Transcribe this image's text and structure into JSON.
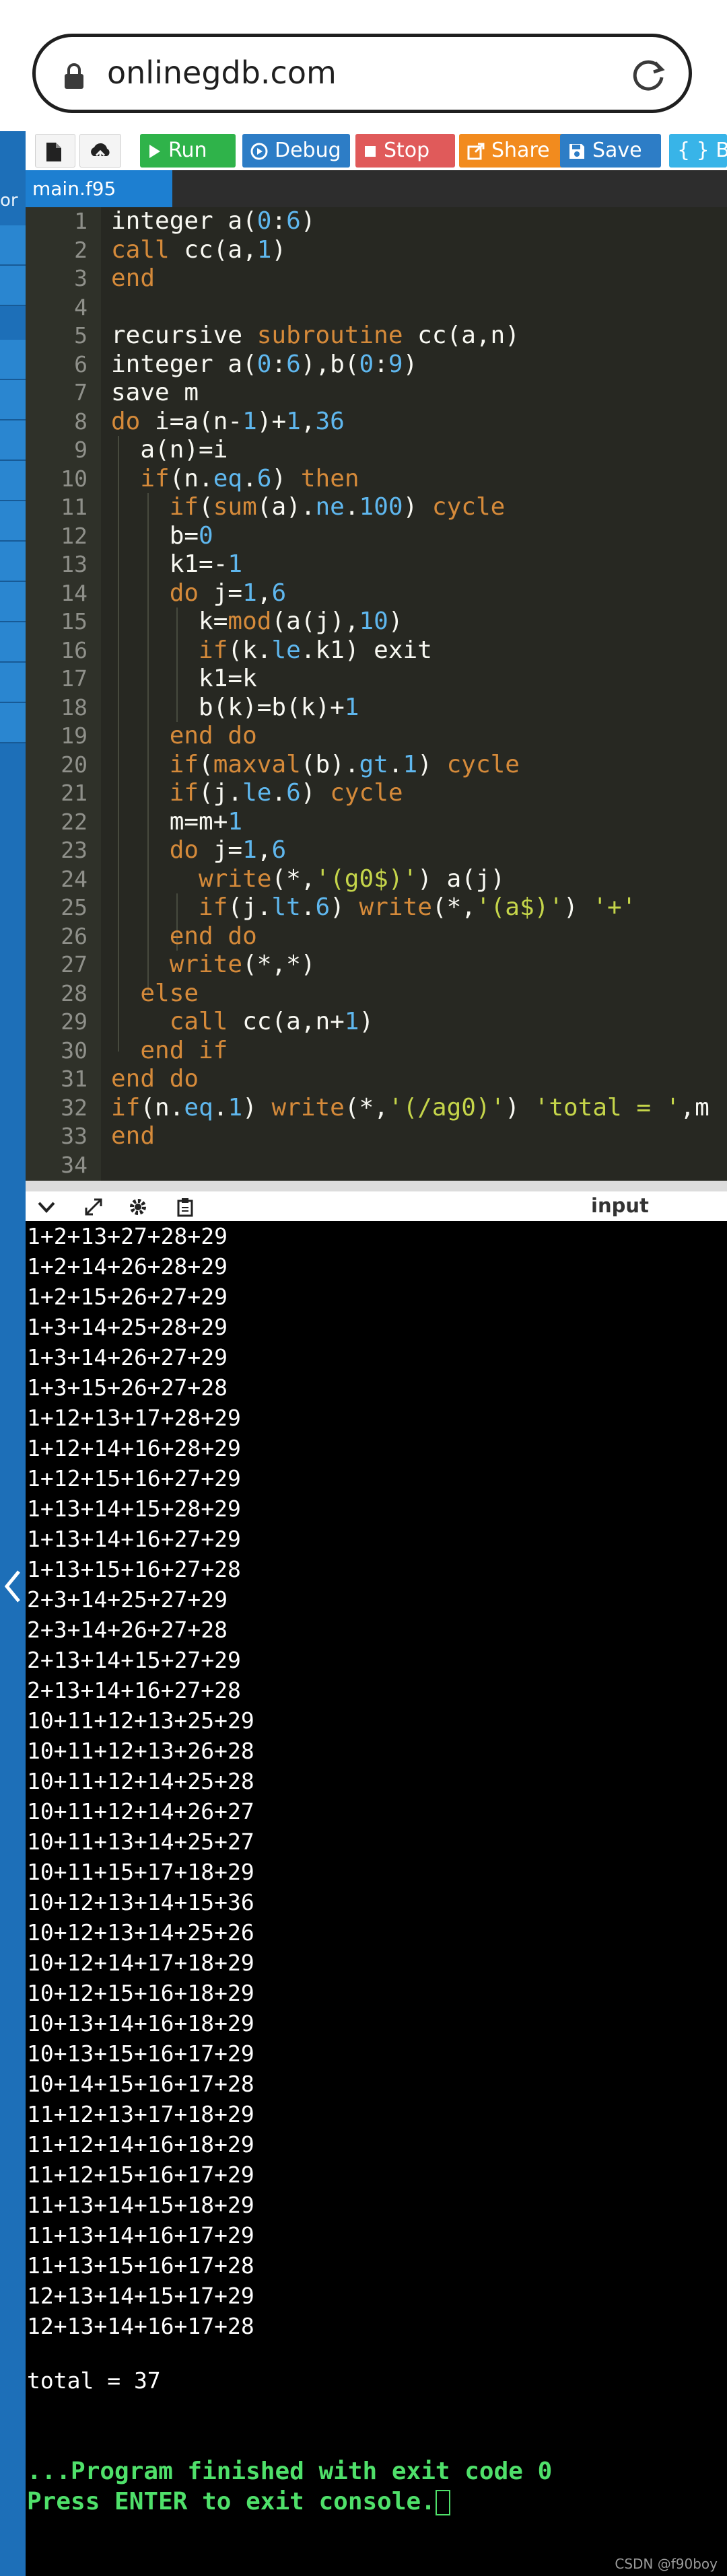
{
  "browser": {
    "url": "onlinegdb.com"
  },
  "sidebar": {
    "partial_label": "or"
  },
  "toolbar": {
    "run_label": "Run",
    "debug_label": "Debug",
    "stop_label": "Stop",
    "share_label": "Share",
    "save_label": "Save",
    "beautify_label": "{ } Bea"
  },
  "editor": {
    "tab_name": "main.f95",
    "lines": [
      [
        {
          "t": "integer a("
        },
        {
          "t": "0",
          "c": "n"
        },
        {
          "t": ":"
        },
        {
          "t": "6",
          "c": "n"
        },
        {
          "t": ")"
        }
      ],
      [
        {
          "t": "call",
          "c": "k"
        },
        {
          "t": " cc(a,"
        },
        {
          "t": "1",
          "c": "n"
        },
        {
          "t": ")"
        }
      ],
      [
        {
          "t": "end",
          "c": "k"
        }
      ],
      [],
      [
        {
          "t": "recursive ",
          "c": ""
        },
        {
          "t": "subroutine",
          "c": "k"
        },
        {
          "t": " cc(a,n)"
        }
      ],
      [
        {
          "t": "integer a("
        },
        {
          "t": "0",
          "c": "n"
        },
        {
          "t": ":"
        },
        {
          "t": "6",
          "c": "n"
        },
        {
          "t": "),b("
        },
        {
          "t": "0",
          "c": "n"
        },
        {
          "t": ":"
        },
        {
          "t": "9",
          "c": "n"
        },
        {
          "t": ")"
        }
      ],
      [
        {
          "t": "save m"
        }
      ],
      [
        {
          "t": "do",
          "c": "k"
        },
        {
          "t": " i=a(n-"
        },
        {
          "t": "1",
          "c": "n"
        },
        {
          "t": ")+"
        },
        {
          "t": "1",
          "c": "n"
        },
        {
          "t": ","
        },
        {
          "t": "36",
          "c": "n"
        }
      ],
      [
        {
          "t": "  a(n)=i"
        }
      ],
      [
        {
          "t": "  "
        },
        {
          "t": "if",
          "c": "k"
        },
        {
          "t": "(n."
        },
        {
          "t": "eq",
          "c": "n"
        },
        {
          "t": "."
        },
        {
          "t": "6",
          "c": "n"
        },
        {
          "t": ") "
        },
        {
          "t": "then",
          "c": "k"
        }
      ],
      [
        {
          "t": "    "
        },
        {
          "t": "if",
          "c": "k"
        },
        {
          "t": "("
        },
        {
          "t": "sum",
          "c": "k"
        },
        {
          "t": "(a)."
        },
        {
          "t": "ne",
          "c": "n"
        },
        {
          "t": "."
        },
        {
          "t": "100",
          "c": "n"
        },
        {
          "t": ") "
        },
        {
          "t": "cycle",
          "c": "k"
        }
      ],
      [
        {
          "t": "    b="
        },
        {
          "t": "0",
          "c": "n"
        }
      ],
      [
        {
          "t": "    k1=-"
        },
        {
          "t": "1",
          "c": "n"
        }
      ],
      [
        {
          "t": "    "
        },
        {
          "t": "do",
          "c": "k"
        },
        {
          "t": " j="
        },
        {
          "t": "1",
          "c": "n"
        },
        {
          "t": ","
        },
        {
          "t": "6",
          "c": "n"
        }
      ],
      [
        {
          "t": "      k="
        },
        {
          "t": "mod",
          "c": "k"
        },
        {
          "t": "(a(j),"
        },
        {
          "t": "10",
          "c": "n"
        },
        {
          "t": ")"
        }
      ],
      [
        {
          "t": "      "
        },
        {
          "t": "if",
          "c": "k"
        },
        {
          "t": "(k."
        },
        {
          "t": "le",
          "c": "n"
        },
        {
          "t": ".k1) exit"
        }
      ],
      [
        {
          "t": "      k1=k"
        }
      ],
      [
        {
          "t": "      b(k)=b(k)+"
        },
        {
          "t": "1",
          "c": "n"
        }
      ],
      [
        {
          "t": "    "
        },
        {
          "t": "end do",
          "c": "k"
        }
      ],
      [
        {
          "t": "    "
        },
        {
          "t": "if",
          "c": "k"
        },
        {
          "t": "("
        },
        {
          "t": "maxval",
          "c": "k"
        },
        {
          "t": "(b)."
        },
        {
          "t": "gt",
          "c": "n"
        },
        {
          "t": "."
        },
        {
          "t": "1",
          "c": "n"
        },
        {
          "t": ") "
        },
        {
          "t": "cycle",
          "c": "k"
        }
      ],
      [
        {
          "t": "    "
        },
        {
          "t": "if",
          "c": "k"
        },
        {
          "t": "(j."
        },
        {
          "t": "le",
          "c": "n"
        },
        {
          "t": "."
        },
        {
          "t": "6",
          "c": "n"
        },
        {
          "t": ") "
        },
        {
          "t": "cycle",
          "c": "k"
        }
      ],
      [
        {
          "t": "    m=m+"
        },
        {
          "t": "1",
          "c": "n"
        }
      ],
      [
        {
          "t": "    "
        },
        {
          "t": "do",
          "c": "k"
        },
        {
          "t": " j="
        },
        {
          "t": "1",
          "c": "n"
        },
        {
          "t": ","
        },
        {
          "t": "6",
          "c": "n"
        }
      ],
      [
        {
          "t": "      "
        },
        {
          "t": "write",
          "c": "k"
        },
        {
          "t": "(*,"
        },
        {
          "t": "'(g0$)'",
          "c": "s"
        },
        {
          "t": ") a(j)"
        }
      ],
      [
        {
          "t": "      "
        },
        {
          "t": "if",
          "c": "k"
        },
        {
          "t": "(j."
        },
        {
          "t": "lt",
          "c": "n"
        },
        {
          "t": "."
        },
        {
          "t": "6",
          "c": "n"
        },
        {
          "t": ") "
        },
        {
          "t": "write",
          "c": "k"
        },
        {
          "t": "(*,"
        },
        {
          "t": "'(a$)'",
          "c": "s"
        },
        {
          "t": ") "
        },
        {
          "t": "'+'",
          "c": "s"
        }
      ],
      [
        {
          "t": "    "
        },
        {
          "t": "end do",
          "c": "k"
        }
      ],
      [
        {
          "t": "    "
        },
        {
          "t": "write",
          "c": "k"
        },
        {
          "t": "(*,*)"
        }
      ],
      [
        {
          "t": "  "
        },
        {
          "t": "else",
          "c": "k"
        }
      ],
      [
        {
          "t": "    "
        },
        {
          "t": "call",
          "c": "k"
        },
        {
          "t": " cc(a,n+"
        },
        {
          "t": "1",
          "c": "n"
        },
        {
          "t": ")"
        }
      ],
      [
        {
          "t": "  "
        },
        {
          "t": "end if",
          "c": "k"
        }
      ],
      [
        {
          "t": "end do",
          "c": "k"
        }
      ],
      [
        {
          "t": "if",
          "c": "k"
        },
        {
          "t": "(n."
        },
        {
          "t": "eq",
          "c": "n"
        },
        {
          "t": "."
        },
        {
          "t": "1",
          "c": "n"
        },
        {
          "t": ") "
        },
        {
          "t": "write",
          "c": "k"
        },
        {
          "t": "(*,"
        },
        {
          "t": "'(/ag0)'",
          "c": "s"
        },
        {
          "t": ") "
        },
        {
          "t": "'total = '",
          "c": "s"
        },
        {
          "t": ",m"
        }
      ],
      [
        {
          "t": "end",
          "c": "k"
        }
      ],
      []
    ]
  },
  "console": {
    "input_label": "input",
    "output_lines": [
      "1+2+13+27+28+29",
      "1+2+14+26+28+29",
      "1+2+15+26+27+29",
      "1+3+14+25+28+29",
      "1+3+14+26+27+29",
      "1+3+15+26+27+28",
      "1+12+13+17+28+29",
      "1+12+14+16+28+29",
      "1+12+15+16+27+29",
      "1+13+14+15+28+29",
      "1+13+14+16+27+29",
      "1+13+15+16+27+28",
      "2+3+14+25+27+29",
      "2+3+14+26+27+28",
      "2+13+14+15+27+29",
      "2+13+14+16+27+28",
      "10+11+12+13+25+29",
      "10+11+12+13+26+28",
      "10+11+12+14+25+28",
      "10+11+12+14+26+27",
      "10+11+13+14+25+27",
      "10+11+15+17+18+29",
      "10+12+13+14+15+36",
      "10+12+13+14+25+26",
      "10+12+14+17+18+29",
      "10+12+15+16+18+29",
      "10+13+14+16+18+29",
      "10+13+15+16+17+29",
      "10+14+15+16+17+28",
      "11+12+13+17+18+29",
      "11+12+14+16+18+29",
      "11+12+15+16+17+29",
      "11+13+14+15+18+29",
      "11+13+14+16+17+29",
      "11+13+15+16+17+28",
      "12+13+14+15+17+29",
      "12+13+14+16+17+28"
    ],
    "total_line": "total = 37",
    "finish_line": "...Program finished with exit code 0",
    "prompt_line": "Press ENTER to exit console."
  },
  "watermark": "CSDN @f90boy"
}
